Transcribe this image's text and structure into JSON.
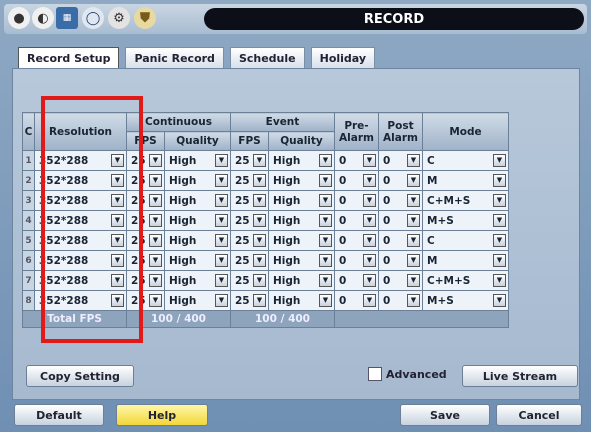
{
  "window": {
    "title": "RECORD"
  },
  "tabs": [
    {
      "label": "Record Setup"
    },
    {
      "label": "Panic Record"
    },
    {
      "label": "Schedule"
    },
    {
      "label": "Holiday"
    }
  ],
  "table": {
    "headers": {
      "ch": "C",
      "resolution": "Resolution",
      "continuous": "Continuous",
      "event": "Event",
      "fps": "FPS",
      "quality": "Quality",
      "pre_alarm": "Pre- Alarm",
      "post_alarm": "Post Alarm",
      "mode": "Mode"
    },
    "rows": [
      {
        "ch": "1",
        "res": "352*288",
        "c_fps": "25",
        "c_quality": "High",
        "e_fps": "25",
        "e_quality": "High",
        "pre": "0",
        "post": "0",
        "mode": "C"
      },
      {
        "ch": "2",
        "res": "352*288",
        "c_fps": "25",
        "c_quality": "High",
        "e_fps": "25",
        "e_quality": "High",
        "pre": "0",
        "post": "0",
        "mode": "M"
      },
      {
        "ch": "3",
        "res": "352*288",
        "c_fps": "25",
        "c_quality": "High",
        "e_fps": "25",
        "e_quality": "High",
        "pre": "0",
        "post": "0",
        "mode": "C+M+S"
      },
      {
        "ch": "4",
        "res": "352*288",
        "c_fps": "25",
        "c_quality": "High",
        "e_fps": "25",
        "e_quality": "High",
        "pre": "0",
        "post": "0",
        "mode": "M+S"
      },
      {
        "ch": "5",
        "res": "352*288",
        "c_fps": "25",
        "c_quality": "High",
        "e_fps": "25",
        "e_quality": "High",
        "pre": "0",
        "post": "0",
        "mode": "C"
      },
      {
        "ch": "6",
        "res": "352*288",
        "c_fps": "25",
        "c_quality": "High",
        "e_fps": "25",
        "e_quality": "High",
        "pre": "0",
        "post": "0",
        "mode": "M"
      },
      {
        "ch": "7",
        "res": "352*288",
        "c_fps": "25",
        "c_quality": "High",
        "e_fps": "25",
        "e_quality": "High",
        "pre": "0",
        "post": "0",
        "mode": "C+M+S"
      },
      {
        "ch": "8",
        "res": "352*288",
        "c_fps": "25",
        "c_quality": "High",
        "e_fps": "25",
        "e_quality": "High",
        "pre": "0",
        "post": "0",
        "mode": "M+S"
      }
    ],
    "total": {
      "label": "Total FPS",
      "continuous": "100 / 400",
      "event": "100 / 400"
    }
  },
  "buttons": {
    "copy_setting": "Copy Setting",
    "advanced": "Advanced",
    "live_stream": "Live Stream",
    "default": "Default",
    "help": "Help",
    "save": "Save",
    "cancel": "Cancel"
  },
  "colors": {
    "highlight": "#e11919"
  }
}
